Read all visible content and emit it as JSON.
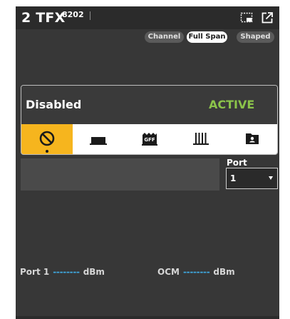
{
  "header": {
    "title": "2 TFX",
    "model": "8202",
    "icons": [
      "display-mode-icon",
      "popout-icon"
    ]
  },
  "view_tabs": [
    {
      "label": "Channel",
      "selected": false
    },
    {
      "label": "Full Span",
      "selected": true
    },
    {
      "label": "Shaped",
      "selected": false
    }
  ],
  "status": {
    "left_text": "Disabled",
    "right_text": "ACTIVE",
    "right_color": "#8bc34a",
    "accent_color": "#f6b51e"
  },
  "modes": [
    {
      "icon": "disabled-icon",
      "selected": true
    },
    {
      "icon": "laser-block-icon",
      "selected": false
    },
    {
      "icon": "gff-icon",
      "selected": false
    },
    {
      "icon": "grid-comb-icon",
      "selected": false
    },
    {
      "icon": "profile-folder-icon",
      "selected": false
    }
  ],
  "port": {
    "label": "Port",
    "value": "1"
  },
  "readings": {
    "port1": {
      "label": "Port 1",
      "value": "--------",
      "unit": "dBm"
    },
    "ocm": {
      "label": "OCM",
      "value": "--------",
      "unit": "dBm"
    },
    "dash_color": "#3fa9e0"
  }
}
